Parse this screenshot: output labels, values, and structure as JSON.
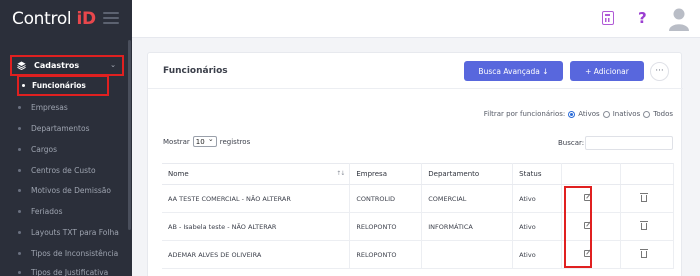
{
  "app": {
    "logo_main": "Control ",
    "logo_accent": "iD"
  },
  "sidebar": {
    "parent_label": "Cadastros",
    "active_label": "Funcionários",
    "items": [
      {
        "label": "Empresas"
      },
      {
        "label": "Departamentos"
      },
      {
        "label": "Cargos"
      },
      {
        "label": "Centros de Custo"
      },
      {
        "label": "Motivos de Demissão"
      },
      {
        "label": "Feriados"
      },
      {
        "label": "Layouts TXT para Folha"
      },
      {
        "label": "Tipos de Inconsistência"
      },
      {
        "label": "Tipos de Justificativa"
      }
    ]
  },
  "topbar": {
    "help_glyph": "?"
  },
  "page": {
    "title": "Funcionários",
    "busca_label": "Busca Avançada ↓",
    "add_label": "+  Adicionar",
    "more_label": "···",
    "filter_label": "Filtrar por funcionários:",
    "filter_options": [
      "Ativos",
      "Inativos",
      "Todos"
    ],
    "filter_selected": "Ativos",
    "show_prefix": "Mostrar",
    "show_value": "10",
    "show_suffix": "registros",
    "search_label": "Buscar:",
    "search_value": ""
  },
  "table": {
    "headers": [
      "Nome",
      "Empresa",
      "Departamento",
      "Status",
      "",
      ""
    ],
    "sort_glyph": "↑↓",
    "rows": [
      {
        "nome": "AA TESTE COMERCIAL - NÃO ALTERAR",
        "empresa": "CONTROLID",
        "departamento": "COMERCIAL",
        "status": "Ativo"
      },
      {
        "nome": "AB - Isabela teste - NÃO ALTERAR",
        "empresa": "RELOPONTO",
        "departamento": "INFORMÁTICA",
        "status": "Ativo"
      },
      {
        "nome": "ADEMAR ALVES DE OLIVEIRA",
        "empresa": "RELOPONTO",
        "departamento": "",
        "status": "Ativo"
      }
    ]
  }
}
